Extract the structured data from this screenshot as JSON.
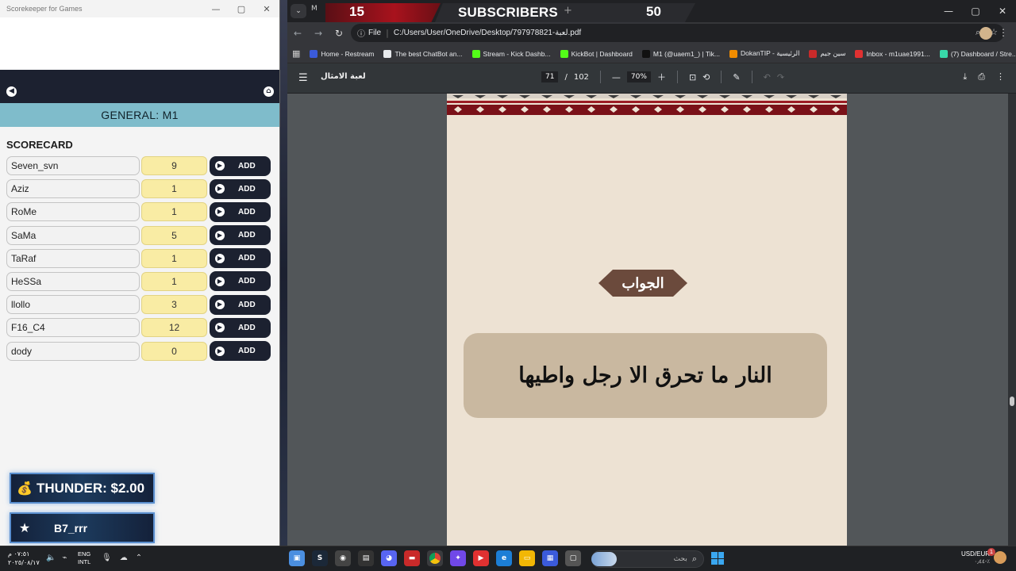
{
  "colors": {
    "general_bar": "#7fbccb",
    "dark_nav": "#1c2130",
    "score_fill": "#f9eca4",
    "proverb_card": "#c9b8a0",
    "page_bg": "#ede2d3",
    "answer_badge": "#6b4a3c",
    "banner_red": "#a8121d"
  },
  "scorekeeper": {
    "window_title": "Scorekeeper for Games",
    "general_title": "GENERAL: M1",
    "scorecard_label": "SCORECARD",
    "add_label": "ADD",
    "players": [
      {
        "name": "Seven_svn",
        "score": "9"
      },
      {
        "name": "Aziz",
        "score": "1"
      },
      {
        "name": "RoMe",
        "score": "1"
      },
      {
        "name": "SaMa",
        "score": "5"
      },
      {
        "name": "TaRaf",
        "score": "1"
      },
      {
        "name": "HeSSa",
        "score": "1"
      },
      {
        "name": "llollo",
        "score": "3"
      },
      {
        "name": "F16_C4",
        "score": "12"
      },
      {
        "name": "dody",
        "score": "0"
      }
    ]
  },
  "overlays": {
    "thunder": "THUNDER: $2.00",
    "b7": "B7_rrr"
  },
  "banner": {
    "left_count": "15",
    "label": "SUBSCRIBERS",
    "right_count": "50"
  },
  "browser": {
    "tab_initial": "M",
    "address_scheme": "File",
    "address_url": "C:/Users/User/OneDrive/Desktop/797978821-لعبة.pdf",
    "bookmarks": [
      {
        "label": "Home - Restream",
        "color": "#3b5bdb",
        "glyph": "R"
      },
      {
        "label": "The best ChatBot an...",
        "color": "#e8eaed",
        "glyph": "◆"
      },
      {
        "label": "Stream - Kick Dashb...",
        "color": "#53fc18",
        "glyph": "K"
      },
      {
        "label": "KickBot | Dashboard",
        "color": "#53fc18",
        "glyph": "●"
      },
      {
        "label": "M1 (@uaem1_) | Tik...",
        "color": "#111111",
        "glyph": "♪"
      },
      {
        "label": "DokanTIP - الرئيسية",
        "color": "#f08c00",
        "glyph": "◧"
      },
      {
        "label": "سين جيم",
        "color": "#c92a2a",
        "glyph": "◐"
      },
      {
        "label": "Inbox - m1uae1991...",
        "color": "#e03131",
        "glyph": "M"
      },
      {
        "label": "(7) Dashboard / Stre...",
        "color": "#38d9a9",
        "glyph": "◼"
      }
    ],
    "pdf": {
      "title": "لعبة الامثال",
      "page_current": "71",
      "page_separator": "/",
      "page_total": "102",
      "zoom": "70%",
      "answer_label": "الجواب",
      "proverb": "النار ما تحرق الا رجل واطيها"
    }
  },
  "taskbar": {
    "time": "٠٧:٥١ م",
    "date": "٢٠٢٥/٠٨/١٧",
    "lang_top": "ENG",
    "lang_bottom": "INTL",
    "search_text": "بحث",
    "currency_top": "USD/EUR",
    "currency_bottom": "٠٫٤٤-٪",
    "notify_count": "1"
  }
}
